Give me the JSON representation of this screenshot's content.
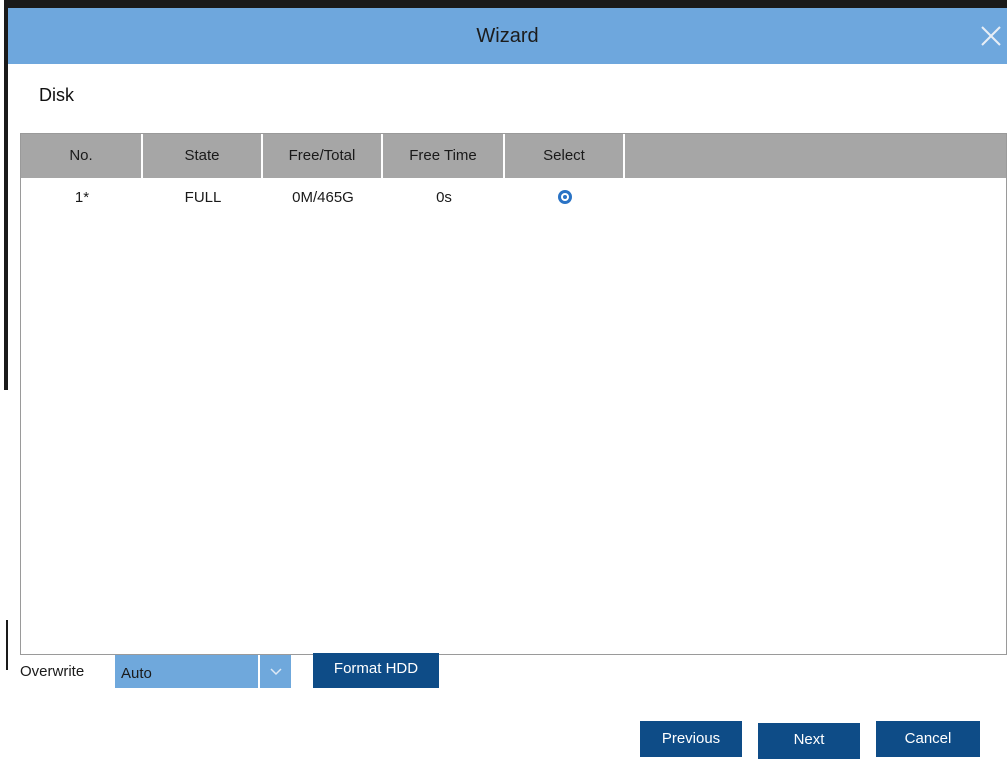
{
  "window": {
    "title": "Wizard"
  },
  "section": {
    "title": "Disk"
  },
  "table": {
    "columns": [
      "No.",
      "State",
      "Free/Total",
      "Free Time",
      "Select"
    ],
    "rows": [
      {
        "no": "1*",
        "state": "FULL",
        "free_total": "0M/465G",
        "free_time": "0s",
        "selected": true
      }
    ]
  },
  "overwrite": {
    "label": "Overwrite",
    "value": "Auto"
  },
  "buttons": {
    "format": "Format HDD",
    "previous": "Previous",
    "next": "Next",
    "cancel": "Cancel"
  },
  "icons": {
    "close": "close-icon",
    "dropdown": "chevron-down-icon",
    "radio": "radio-selected-icon"
  },
  "colors": {
    "titlebar": "#6ea7dd",
    "header": "#a6a6a6",
    "button": "#0e4c87",
    "select": "#6fa8dc",
    "radio": "#2a73c5"
  }
}
